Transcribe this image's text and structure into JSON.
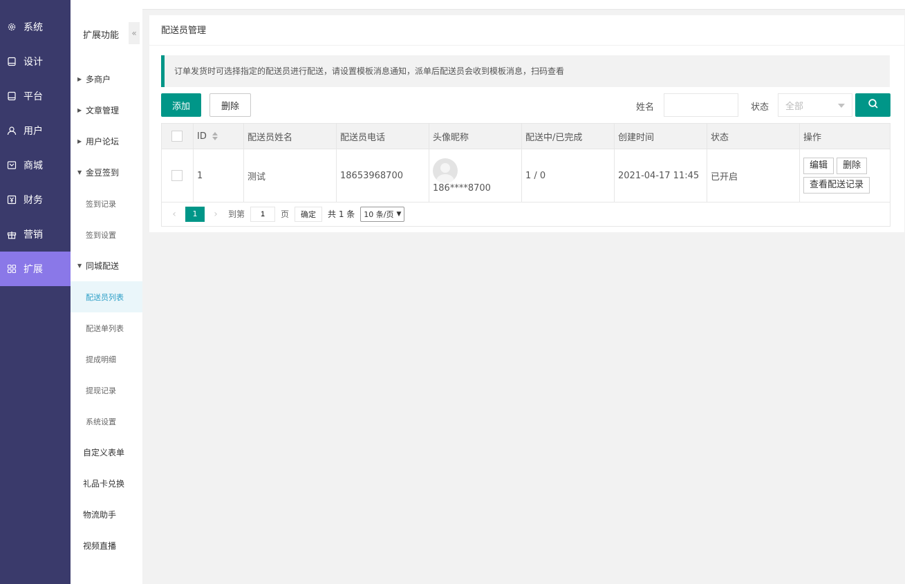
{
  "main_nav": [
    {
      "label": "系统",
      "icon": "gear-icon"
    },
    {
      "label": "设计",
      "icon": "tablet-icon"
    },
    {
      "label": "平台",
      "icon": "tablet-icon"
    },
    {
      "label": "用户",
      "icon": "user-icon"
    },
    {
      "label": "商城",
      "icon": "store-icon"
    },
    {
      "label": "财务",
      "icon": "yen-icon"
    },
    {
      "label": "营销",
      "icon": "gift-icon"
    },
    {
      "label": "扩展",
      "icon": "grid-icon",
      "active": true
    }
  ],
  "sub_nav": {
    "title": "扩展功能",
    "collapse": "«",
    "items": [
      {
        "label": "多商户",
        "level": 1,
        "caret": "▶"
      },
      {
        "label": "文章管理",
        "level": 1,
        "caret": "▶"
      },
      {
        "label": "用户论坛",
        "level": 1,
        "caret": "▶"
      },
      {
        "label": "金豆签到",
        "level": 1,
        "caret": "▼"
      },
      {
        "label": "签到记录",
        "level": 2
      },
      {
        "label": "签到设置",
        "level": 2
      },
      {
        "label": "同城配送",
        "level": 1,
        "caret": "▼"
      },
      {
        "label": "配送员列表",
        "level": 2,
        "active": true
      },
      {
        "label": "配送单列表",
        "level": 2
      },
      {
        "label": "提成明细",
        "level": 2
      },
      {
        "label": "提现记录",
        "level": 2
      },
      {
        "label": "系统设置",
        "level": 2
      },
      {
        "label": "自定义表单",
        "level": 0
      },
      {
        "label": "礼品卡兑换",
        "level": 0
      },
      {
        "label": "物流助手",
        "level": 0
      },
      {
        "label": "视频直播",
        "level": 0
      }
    ]
  },
  "page": {
    "title": "配送员管理",
    "notice": "订单发货时可选择指定的配送员进行配送，请设置模板消息通知，派单后配送员会收到模板消息，扫码查看"
  },
  "toolbar": {
    "add_label": "添加",
    "delete_label": "删除",
    "name_label": "姓名",
    "name_value": "",
    "status_label": "状态",
    "status_value": "全部"
  },
  "table": {
    "columns": [
      "ID",
      "配送员姓名",
      "配送员电话",
      "头像昵称",
      "配送中/已完成",
      "创建时间",
      "状态",
      "操作"
    ],
    "rows": [
      {
        "id": "1",
        "name": "测试",
        "phone": "18653968700",
        "nickname": "186****8700",
        "progress": "1 / 0",
        "created": "2021-04-17 11:45",
        "status": "已开启",
        "actions": {
          "edit": "编辑",
          "delete": "删除",
          "records": "查看配送记录"
        }
      }
    ]
  },
  "pagination": {
    "current": "1",
    "goto_label": "到第",
    "goto_value": "1",
    "page_unit": "页",
    "ok_label": "确定",
    "total": "共 1 条",
    "page_size": "10 条/页"
  },
  "colors": {
    "accent": "#009688",
    "sidebar": "#3a3a6b",
    "active_nav": "#8a78e8"
  }
}
